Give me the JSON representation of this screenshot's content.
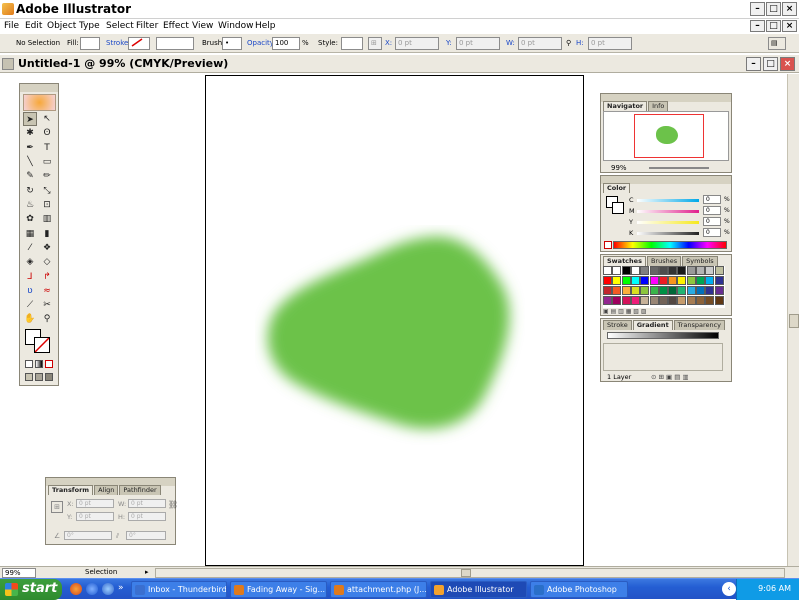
{
  "app": {
    "title": "Adobe Illustrator",
    "menu": [
      "File",
      "Edit",
      "Object",
      "Type",
      "Select",
      "Filter",
      "Effect",
      "View",
      "Window",
      "Help"
    ]
  },
  "control_bar": {
    "selection_label": "No Selection",
    "fill_label": "Fill:",
    "stroke_label": "Stroke:",
    "brush_label": "Brush:",
    "opacity_label": "Opacity:",
    "opacity_value": "100",
    "opacity_unit": "%",
    "style_label": "Style:",
    "x_label": "X:",
    "x_value": "0 pt",
    "y_label": "Y:",
    "y_value": "0 pt",
    "w_label": "W:",
    "w_value": "0 pt",
    "h_label": "H:",
    "h_value": "0 pt"
  },
  "document": {
    "title": "Untitled-1 @ 99% (CMYK/Preview)"
  },
  "canvas": {
    "blob_color": "#6cc24a"
  },
  "navigator_panel": {
    "tabs": [
      "Navigator",
      "Info"
    ],
    "zoom": "99%"
  },
  "color_panel": {
    "tab": "Color",
    "channels": [
      {
        "label": "C",
        "value": "0",
        "unit": "%",
        "color": "#00a8e8"
      },
      {
        "label": "M",
        "value": "0",
        "unit": "%",
        "color": "#e0208c"
      },
      {
        "label": "Y",
        "value": "0",
        "unit": "%",
        "color": "#f5e81e"
      },
      {
        "label": "K",
        "value": "0",
        "unit": "%",
        "color": "#222222"
      }
    ]
  },
  "swatches_panel": {
    "tabs": [
      "Swatches",
      "Brushes",
      "Symbols"
    ]
  },
  "gradient_panel": {
    "tabs": [
      "Stroke",
      "Gradient",
      "Transparency"
    ]
  },
  "layers_panel": {
    "count_label": "1 Layer"
  },
  "transform_panel": {
    "tabs": [
      "Transform",
      "Align",
      "Pathfinder"
    ],
    "x_label": "X:",
    "x_value": "0 pt",
    "y_label": "Y:",
    "y_value": "0 pt",
    "w_label": "W:",
    "w_value": "0 pt",
    "h_label": "H:",
    "h_value": "0 pt",
    "angle_value": "0°",
    "shear_value": "0°"
  },
  "status_bar": {
    "zoom": "99%",
    "mode": "Selection"
  },
  "taskbar": {
    "start_label": "start",
    "items": [
      {
        "label": "Inbox - Thunderbird",
        "color": "#3a6fd0",
        "active": false
      },
      {
        "label": "Fading Away - Sig...",
        "color": "#e07a1b",
        "active": false
      },
      {
        "label": "attachment.php (J...",
        "color": "#e07a1b",
        "active": false
      },
      {
        "label": "Adobe Illustrator",
        "color": "#f4a22d",
        "active": true
      },
      {
        "label": "Adobe Photoshop",
        "color": "#2a6fc9",
        "active": false
      }
    ],
    "clock": "9:06 AM"
  }
}
